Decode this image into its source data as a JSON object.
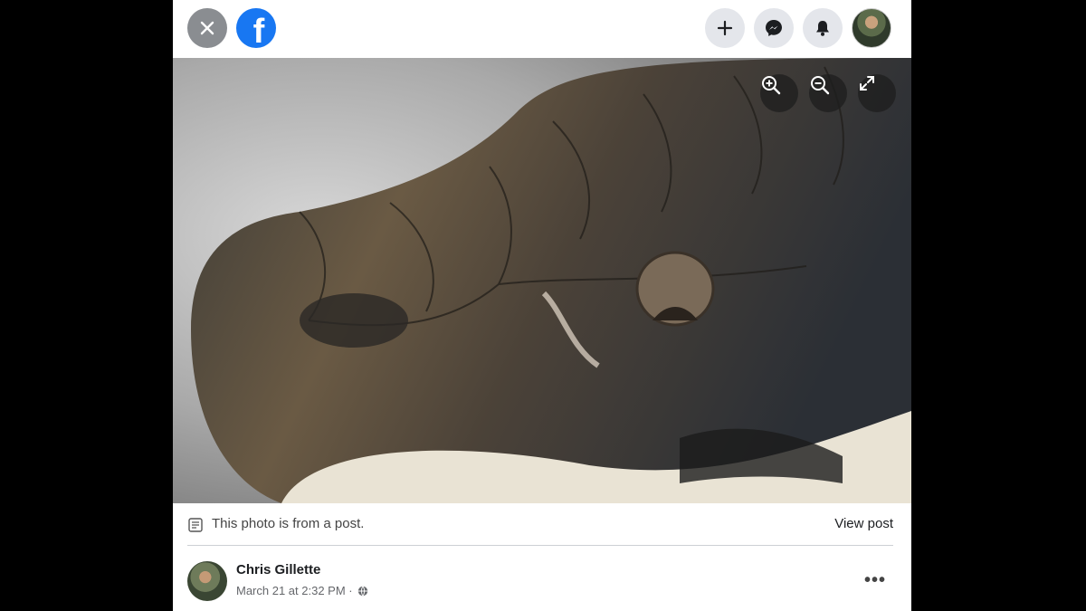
{
  "header": {
    "logo_letter": "f",
    "icons": [
      "close-icon",
      "facebook-logo-icon",
      "plus-icon",
      "messenger-icon",
      "bell-icon",
      "profile-avatar"
    ]
  },
  "photo": {
    "controls": [
      "zoom-in-icon",
      "zoom-out-icon",
      "fullscreen-icon"
    ]
  },
  "post_info": {
    "note": "This photo is from a post.",
    "view_post": "View post"
  },
  "author": {
    "name": "Chris Gillette",
    "timestamp": "March 21 at 2:32 PM ·"
  },
  "more_label": "•••",
  "colors": {
    "facebook_blue": "#1877f2",
    "close_gray": "#8a8d91",
    "button_gray": "#e4e6eb",
    "text_secondary": "#65676b"
  }
}
